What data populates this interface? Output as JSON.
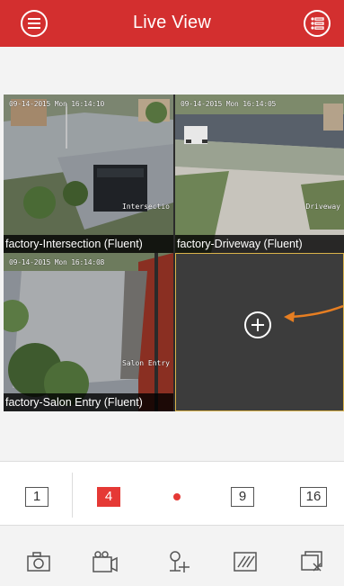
{
  "header": {
    "title": "Live View",
    "menu_icon": "menu-list-icon",
    "right_icon": "device-list-icon",
    "bg_color": "#d32f2f"
  },
  "cameras": [
    {
      "label": "factory-Intersection (Fluent)",
      "osd_time": "09-14-2015 Mon 16:14:10",
      "osd_name": "Intersectio"
    },
    {
      "label": "factory-Driveway (Fluent)",
      "osd_time": "09-14-2015 Mon 16:14:05",
      "osd_name": "Driveway"
    },
    {
      "label": "factory-Salon Entry (Fluent)",
      "osd_time": "09-14-2015 Mon 16:14:08",
      "osd_name": "Salon Entry"
    }
  ],
  "empty_cell": {
    "icon": "add-camera-icon",
    "accent": "#e67e22"
  },
  "split_bar": {
    "options": [
      "1",
      "4",
      "9",
      "16"
    ],
    "selected": "4",
    "accent": "#e53935"
  },
  "toolbar": {
    "icons": [
      "capture-icon",
      "record-icon",
      "ptz-icon",
      "quality-icon",
      "close-all-icon"
    ]
  }
}
